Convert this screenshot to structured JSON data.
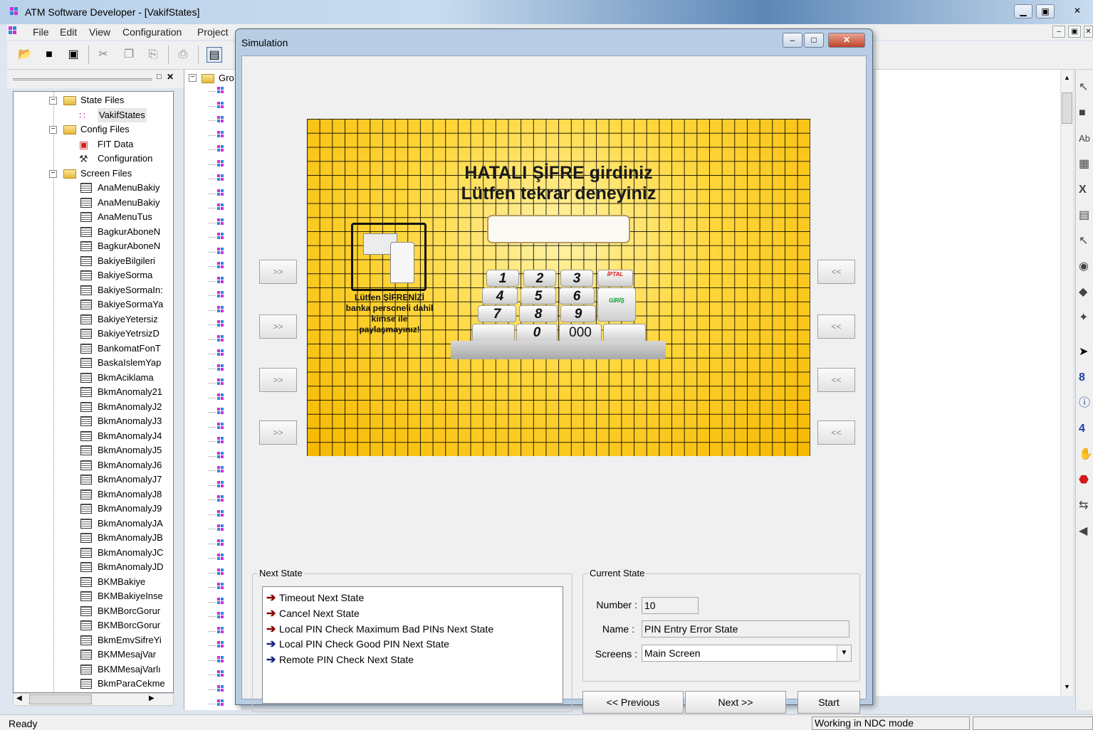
{
  "window": {
    "title": "ATM Software Developer - [VakifStates]",
    "controls": [
      "▁",
      "▣",
      "✕"
    ]
  },
  "menu": {
    "items": [
      "File",
      "Edit",
      "View",
      "Configuration",
      "Project"
    ],
    "mdi_controls": [
      "‒",
      "▣",
      "✕"
    ]
  },
  "tree": {
    "items": [
      {
        "label": "State Files",
        "kind": "folder",
        "indent": 0
      },
      {
        "label": "VakifStates",
        "kind": "states",
        "indent": 1
      },
      {
        "label": "Config Files",
        "kind": "folder",
        "indent": 0
      },
      {
        "label": "FIT Data",
        "kind": "fit",
        "indent": 1
      },
      {
        "label": "Configuration",
        "kind": "tools",
        "indent": 1
      },
      {
        "label": "Screen Files",
        "kind": "folder",
        "indent": 0
      },
      {
        "label": "AnaMenuBakiy",
        "kind": "screen",
        "indent": 1
      },
      {
        "label": "AnaMenuBakiy",
        "kind": "screen",
        "indent": 1
      },
      {
        "label": "AnaMenuTus",
        "kind": "screen",
        "indent": 1
      },
      {
        "label": "BagkurAboneN",
        "kind": "screen",
        "indent": 1
      },
      {
        "label": "BagkurAboneN",
        "kind": "screen",
        "indent": 1
      },
      {
        "label": "BakiyeBilgileri",
        "kind": "screen",
        "indent": 1
      },
      {
        "label": "BakiyeSorma",
        "kind": "screen",
        "indent": 1
      },
      {
        "label": "BakiyeSormaIn:",
        "kind": "screen",
        "indent": 1
      },
      {
        "label": "BakiyeSormaYa",
        "kind": "screen",
        "indent": 1
      },
      {
        "label": "BakiyeYetersiz",
        "kind": "screen",
        "indent": 1
      },
      {
        "label": "BakiyeYetrsizD",
        "kind": "screen",
        "indent": 1
      },
      {
        "label": "BankomatFonT",
        "kind": "screen",
        "indent": 1
      },
      {
        "label": "BaskaIslemYap",
        "kind": "screen",
        "indent": 1
      },
      {
        "label": "BkmAciklama",
        "kind": "screen",
        "indent": 1
      },
      {
        "label": "BkmAnomaly21",
        "kind": "screen",
        "indent": 1
      },
      {
        "label": "BkmAnomalyJ2",
        "kind": "screen",
        "indent": 1
      },
      {
        "label": "BkmAnomalyJ3",
        "kind": "screen",
        "indent": 1
      },
      {
        "label": "BkmAnomalyJ4",
        "kind": "screen",
        "indent": 1
      },
      {
        "label": "BkmAnomalyJ5",
        "kind": "screen",
        "indent": 1
      },
      {
        "label": "BkmAnomalyJ6",
        "kind": "screen",
        "indent": 1
      },
      {
        "label": "BkmAnomalyJ7",
        "kind": "screen",
        "indent": 1
      },
      {
        "label": "BkmAnomalyJ8",
        "kind": "screen",
        "indent": 1
      },
      {
        "label": "BkmAnomalyJ9",
        "kind": "screen",
        "indent": 1
      },
      {
        "label": "BkmAnomalyJA",
        "kind": "screen",
        "indent": 1
      },
      {
        "label": "BkmAnomalyJB",
        "kind": "screen",
        "indent": 1
      },
      {
        "label": "BkmAnomalyJC",
        "kind": "screen",
        "indent": 1
      },
      {
        "label": "BkmAnomalyJD",
        "kind": "screen",
        "indent": 1
      },
      {
        "label": "BKMBakiye",
        "kind": "screen",
        "indent": 1
      },
      {
        "label": "BKMBakiyeInse",
        "kind": "screen",
        "indent": 1
      },
      {
        "label": "BKMBorcGorur",
        "kind": "screen",
        "indent": 1
      },
      {
        "label": "BKMBorcGorur",
        "kind": "screen",
        "indent": 1
      },
      {
        "label": "BkmEmvSifreYi",
        "kind": "screen",
        "indent": 1
      },
      {
        "label": "BKMMesajVar",
        "kind": "screen",
        "indent": 1
      },
      {
        "label": "BKMMesajVarlı",
        "kind": "screen",
        "indent": 1
      },
      {
        "label": "BkmParaCekme",
        "kind": "screen",
        "indent": 1
      }
    ]
  },
  "pane2": {
    "label": "Gro"
  },
  "simulation": {
    "title": "Simulation",
    "screen": {
      "line1": "HATALI ŞİFRE girdiniz",
      "line2": "Lütfen tekrar deneyiniz",
      "warning": "Lütfen ŞİFRENİZİ banka personeli dahil kimse ile paylaşmayınız!",
      "keys": [
        "1",
        "2",
        "3",
        "4",
        "5",
        "6",
        "7",
        "8",
        "9",
        "0",
        "000"
      ],
      "key_labels": {
        "cancel": "İPTAL",
        "enter": "GİRİŞ"
      }
    },
    "fdk_left": ">>",
    "fdk_right": "<<",
    "next_state": {
      "label": "Next State",
      "items": [
        {
          "text": "Timeout Next State",
          "color": "#8b0000"
        },
        {
          "text": "Cancel Next State",
          "color": "#8b0000"
        },
        {
          "text": "Local PIN Check Maximum Bad PINs Next State",
          "color": "#8b0000"
        },
        {
          "text": "Local PIN Check Good PIN Next State",
          "color": "#1a237e"
        },
        {
          "text": "Remote PIN Check Next State",
          "color": "#1a237e"
        }
      ]
    },
    "current_state": {
      "label": "Current State",
      "number_label": "Number :",
      "number": "10",
      "name_label": "Name :",
      "name": "PIN Entry Error State",
      "screens_label": "Screens :",
      "screens": "Main Screen"
    },
    "buttons": {
      "previous": "<< Previous",
      "next": "Next >>",
      "start": "Start"
    }
  },
  "status": {
    "left": "Ready",
    "mode": "Working in NDC mode"
  },
  "colors": {
    "screen_yellow": "#ffd63a",
    "title_blue": "#b9d1ea"
  }
}
